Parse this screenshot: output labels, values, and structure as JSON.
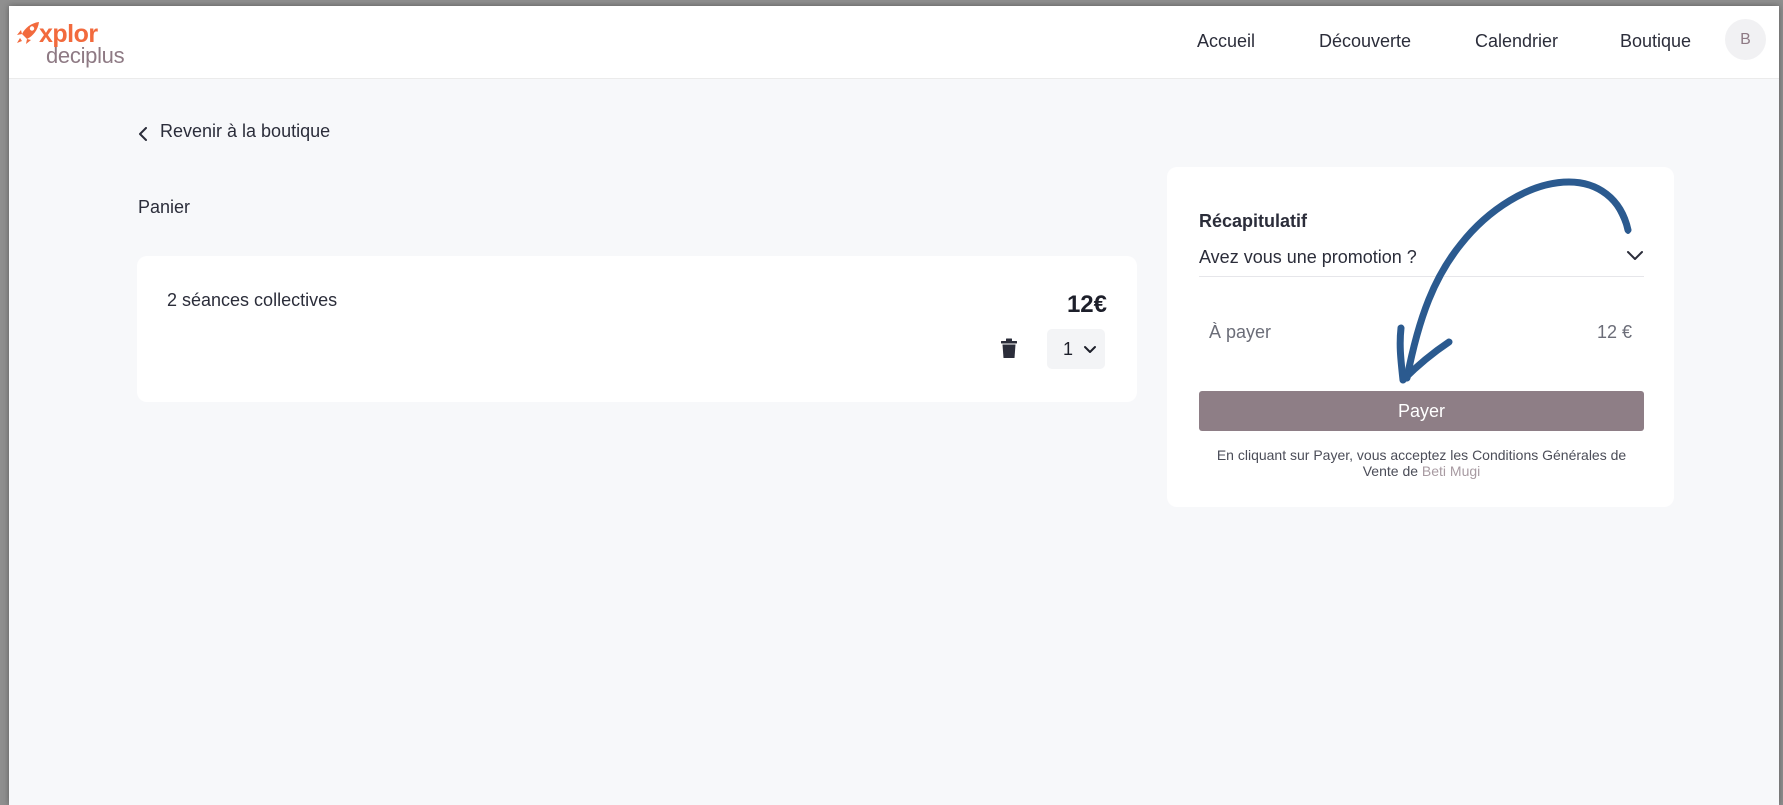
{
  "brand": {
    "logo_top": "xplor",
    "logo_bottom": "deciplus",
    "accent_color": "#f26a3d",
    "secondary_color": "#8e7a84"
  },
  "nav": {
    "items": [
      {
        "label": "Accueil"
      },
      {
        "label": "Découverte"
      },
      {
        "label": "Calendrier"
      },
      {
        "label": "Boutique"
      }
    ],
    "avatar_initial": "B"
  },
  "back_link": {
    "icon": "chevron-left-icon",
    "label": "Revenir à la boutique"
  },
  "cart": {
    "title": "Panier",
    "items": [
      {
        "name": "2 séances collectives",
        "price": "12€",
        "quantity": "1",
        "delete_icon": "trash-icon",
        "quantity_icon": "chevron-down-icon"
      }
    ]
  },
  "summary": {
    "title": "Récapitulatif",
    "promo_label": "Avez vous une promotion ?",
    "promo_icon": "chevron-down-icon",
    "to_pay_label": "À payer",
    "to_pay_value": "12 €",
    "pay_button": "Payer",
    "pay_button_color": "#8e7e86",
    "terms_text": "En cliquant sur Payer, vous acceptez les Conditions Générales de Vente de",
    "terms_org": "Beti Mugi"
  },
  "annotation": {
    "icon": "hand-drawn-arrow",
    "color": "#2b5a8f"
  }
}
